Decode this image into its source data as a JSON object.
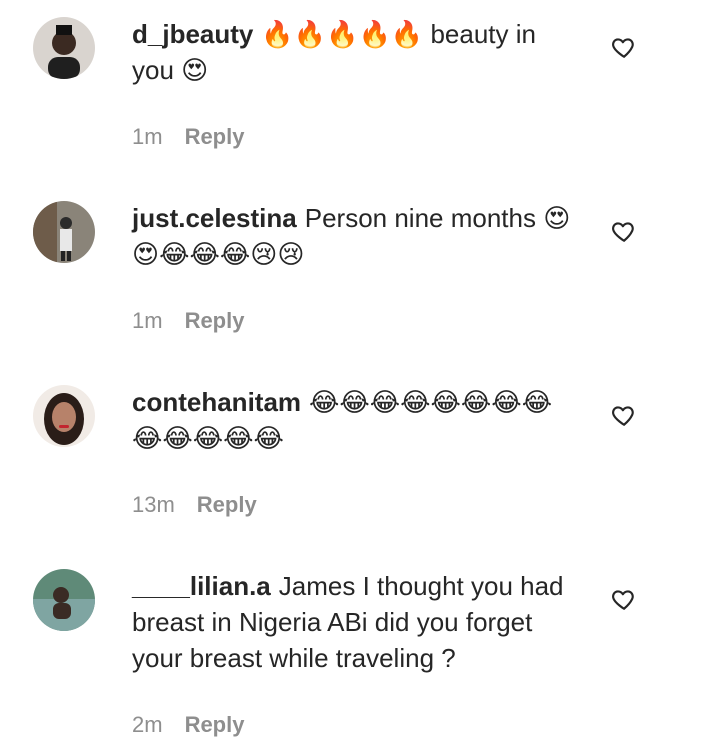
{
  "comments": [
    {
      "username": "d_jbeauty",
      "text": "🔥🔥🔥🔥🔥 beauty in you 😍",
      "time": "1m",
      "reply_label": "Reply",
      "avatar_icon": "user-avatar-icon"
    },
    {
      "username": "just.celestina",
      "text": "Person nine months 😍😍😂😂😂😢😢",
      "time": "1m",
      "reply_label": "Reply",
      "avatar_icon": "user-avatar-icon"
    },
    {
      "username": "contehanitam",
      "text": "😂😂😂😂😂😂😂😂😂😂😂😂😂",
      "time": "13m",
      "reply_label": "Reply",
      "avatar_icon": "user-avatar-icon"
    },
    {
      "username": "____lilian.a",
      "text": "James I thought you had breast in Nigeria ABi did you forget your breast while traveling ?",
      "time": "2m",
      "reply_label": "Reply",
      "avatar_icon": "user-avatar-icon"
    }
  ],
  "icons": {
    "like": "heart-icon"
  },
  "colors": {
    "text": "#262626",
    "meta": "#8e8e8e",
    "background": "#ffffff"
  }
}
